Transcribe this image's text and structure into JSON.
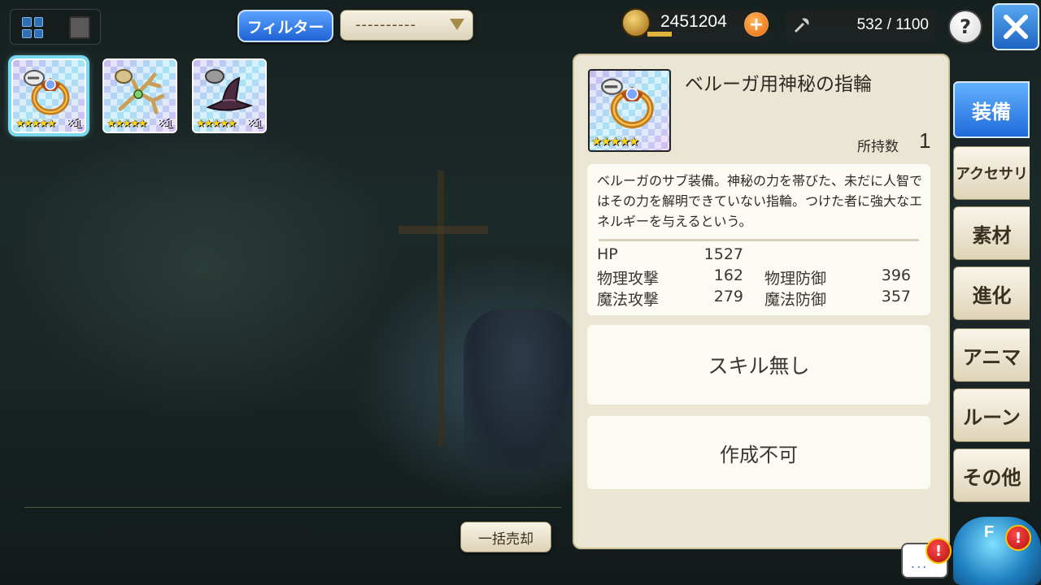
{
  "toolbar": {
    "filter_label": "フィルター",
    "filter_value": "----------",
    "gold": "2451204",
    "capacity": "532 / 1100",
    "help_label": "?"
  },
  "inventory": {
    "items": [
      {
        "stars": "★★★★★",
        "qty": "×1",
        "icon": "ring-icon"
      },
      {
        "stars": "★★★★★",
        "qty": "×1",
        "icon": "antler-icon"
      },
      {
        "stars": "★★★★★",
        "qty": "×1",
        "icon": "hat-icon"
      }
    ],
    "bulk_sell_label": "一括売却"
  },
  "detail": {
    "name": "ベルーガ用神秘の指輪",
    "stars": "★★★★★",
    "owned_label": "所持数",
    "owned_value": "1",
    "description": "ベルーガのサブ装備。神秘の力を帯びた、未だに人智ではその力を解明できていない指輪。つけた者に強大なエネルギーを与えるという。",
    "stats": {
      "hp_label": "HP",
      "hp": "1527",
      "patk_label": "物理攻撃",
      "patk": "162",
      "pdef_label": "物理防御",
      "pdef": "396",
      "matk_label": "魔法攻撃",
      "matk": "279",
      "mdef_label": "魔法防御",
      "mdef": "357"
    },
    "skill": "スキル無し",
    "craft": "作成不可"
  },
  "tabs": [
    {
      "label": "装備"
    },
    {
      "label": "アクセサリ"
    },
    {
      "label": "素材"
    },
    {
      "label": "進化"
    },
    {
      "label": "アニマ"
    },
    {
      "label": "ルーン"
    },
    {
      "label": "その他"
    }
  ],
  "mascot": {
    "label": "F",
    "alert": "!"
  },
  "chat": {
    "dots": "...",
    "alert": "!"
  },
  "colors": {
    "accent_blue": "#1f6ad8",
    "panel_bg": "#ebe5d3",
    "star": "#ffd21c",
    "selected_glow": "#7ad8ee"
  }
}
